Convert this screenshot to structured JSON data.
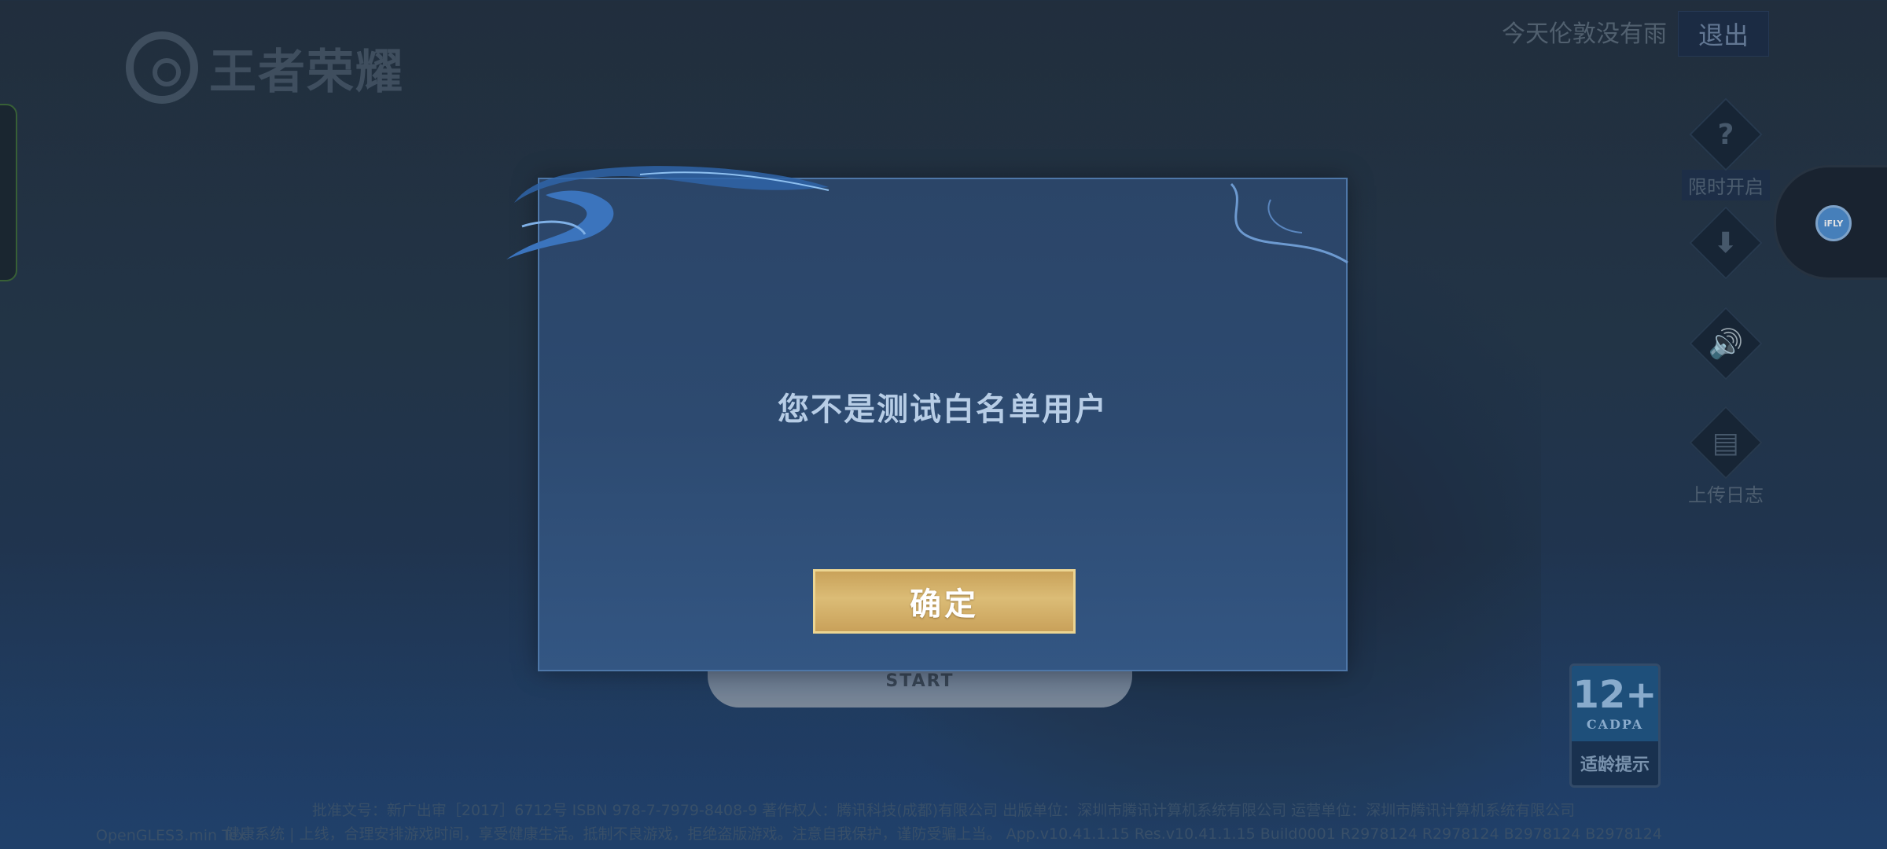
{
  "game_logo": {
    "text": "王者荣耀"
  },
  "account": {
    "name": "今天伦敦没有雨",
    "logout_label": "退出"
  },
  "side_buttons": [
    {
      "icon": "question-icon",
      "label": "限时开启"
    },
    {
      "icon": "download-icon",
      "label": ""
    },
    {
      "icon": "speaker-icon",
      "label": ""
    },
    {
      "icon": "clipboard-icon",
      "label": "上传日志"
    }
  ],
  "float_ball": {
    "label": "iFLY"
  },
  "start_label": "START",
  "age_rating": {
    "number": "12+",
    "org": "CADPA",
    "label": "适龄提示"
  },
  "footer": {
    "line1": "批准文号：新广出审［2017］6712号 ISBN 978-7-7979-8408-9 著作权人：腾讯科技(成都)有限公司 出版单位：深圳市腾讯计算机系统有限公司 运营单位：深圳市腾讯计算机系统有限公司",
    "line2": "健康系统 | 上线，合理安排游戏时间，享受健康生活。抵制不良游戏，拒绝盗版游戏。注意自我保护，谨防受骗上当。 App.v10.41.1.15 Res.v10.41.1.15 Build0001 R2978124 R2978124 B2978124 B2978124",
    "gl": "OpenGLES3.min Tex"
  },
  "dialog": {
    "message": "您不是测试白名单用户",
    "ok_label": "确定"
  },
  "colors": {
    "dialog_bg": "#2d4a70",
    "button_gold": "#d4b26a",
    "message_text": "#b7cde6"
  }
}
